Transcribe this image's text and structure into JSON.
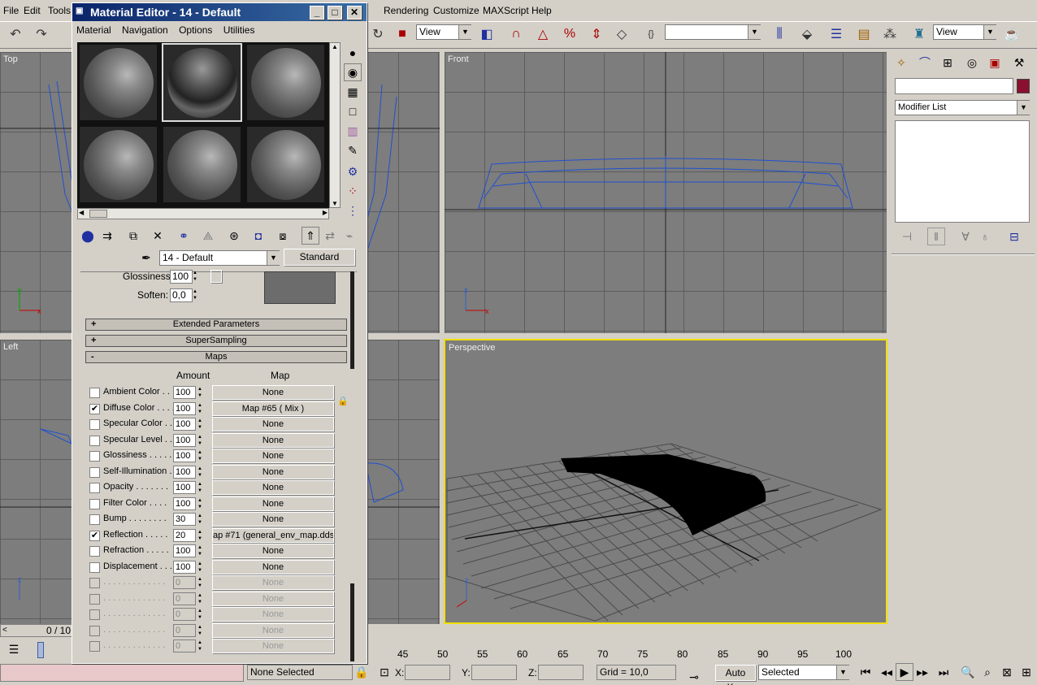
{
  "menubar": [
    "File",
    "Edit",
    "Tools",
    "Rendering",
    "Customize",
    "MAXScript",
    "Help"
  ],
  "toolbar": {
    "ref_coord_left": "View",
    "ref_coord_right": "View",
    "named_sel": ""
  },
  "viewports": {
    "top": "Top",
    "front": "Front",
    "left": "Left",
    "perspective": "Perspective"
  },
  "material_editor": {
    "title": "Material Editor - 14 - Default",
    "menu": [
      "Material",
      "Navigation",
      "Options",
      "Utilities"
    ],
    "material_name": "14 - Default",
    "material_type": "Standard",
    "glossiness_label": "Glossiness:",
    "glossiness_value": "100",
    "soften_label": "Soften:",
    "soften_value": "0,0",
    "rollouts": {
      "extended": "Extended Parameters",
      "supersampling": "SuperSampling",
      "maps": "Maps"
    },
    "maps_header": {
      "amount": "Amount",
      "map": "Map"
    },
    "maps": [
      {
        "name": "Ambient Color . . .",
        "checked": false,
        "amount": "100",
        "map": "None",
        "disabled": false
      },
      {
        "name": "Diffuse Color . . . .",
        "checked": true,
        "amount": "100",
        "map": "Map #65  ( Mix )",
        "disabled": false
      },
      {
        "name": "Specular Color  . .",
        "checked": false,
        "amount": "100",
        "map": "None",
        "disabled": false
      },
      {
        "name": "Specular Level  . .",
        "checked": false,
        "amount": "100",
        "map": "None",
        "disabled": false
      },
      {
        "name": "Glossiness  . . . . .",
        "checked": false,
        "amount": "100",
        "map": "None",
        "disabled": false
      },
      {
        "name": "Self-Illumination .",
        "checked": false,
        "amount": "100",
        "map": "None",
        "disabled": false
      },
      {
        "name": "Opacity  . . . . . . .",
        "checked": false,
        "amount": "100",
        "map": "None",
        "disabled": false
      },
      {
        "name": "Filter Color  . . . .",
        "checked": false,
        "amount": "100",
        "map": "None",
        "disabled": false
      },
      {
        "name": "Bump  . . . . . . . .",
        "checked": false,
        "amount": "30",
        "map": "None",
        "disabled": false
      },
      {
        "name": "Reflection  . . . . .",
        "checked": true,
        "amount": "20",
        "map": "ap #71 (general_env_map.dds)",
        "disabled": false
      },
      {
        "name": "Refraction  . . . . .",
        "checked": false,
        "amount": "100",
        "map": "None",
        "disabled": false
      },
      {
        "name": "Displacement  . . .",
        "checked": false,
        "amount": "100",
        "map": "None",
        "disabled": false
      },
      {
        "name": ". . . . . . . . . . . . .",
        "checked": false,
        "amount": "0",
        "map": "None",
        "disabled": true
      },
      {
        "name": ". . . . . . . . . . . . .",
        "checked": false,
        "amount": "0",
        "map": "None",
        "disabled": true
      },
      {
        "name": ". . . . . . . . . . . . .",
        "checked": false,
        "amount": "0",
        "map": "None",
        "disabled": true
      },
      {
        "name": ". . . . . . . . . . . . .",
        "checked": false,
        "amount": "0",
        "map": "None",
        "disabled": true
      },
      {
        "name": ". . . . . . . . . . . . .",
        "checked": false,
        "amount": "0",
        "map": "None",
        "disabled": true
      }
    ]
  },
  "command_panel": {
    "name_field": "",
    "modifier_list": "Modifier List"
  },
  "timeline": {
    "frame_counter": "0 / 10",
    "ticks": [
      "45",
      "50",
      "55",
      "60",
      "65",
      "70",
      "75",
      "80",
      "85",
      "90",
      "95",
      "100"
    ]
  },
  "statusbar": {
    "selection": "None Selected",
    "x_label": "X:",
    "y_label": "Y:",
    "z_label": "Z:",
    "grid": "Grid = 10,0",
    "autokey": "Auto Key",
    "selected": "Selected"
  },
  "colors": {
    "viewport_bg": "#7d7d7d",
    "wire_blue": "#2050d0",
    "active_border": "#f0e000",
    "swatch_red": "#8a1030"
  }
}
